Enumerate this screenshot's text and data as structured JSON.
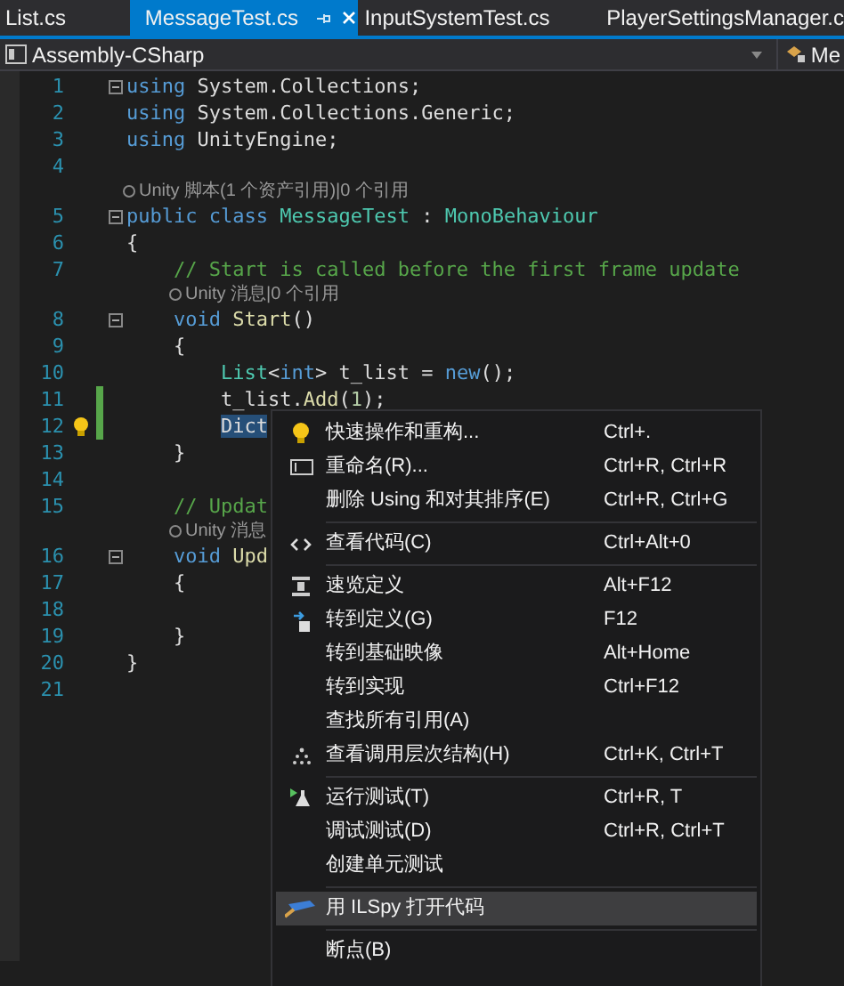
{
  "tabs": [
    {
      "label": "List.cs",
      "selected": false
    },
    {
      "label": "MessageTest.cs",
      "selected": true
    },
    {
      "label": "InputSystemTest.cs",
      "selected": false
    },
    {
      "label": "PlayerSettingsManager.c",
      "selected": false
    }
  ],
  "nav": {
    "project": "Assembly-CSharp",
    "member": "Me"
  },
  "lines": [
    {
      "kind": "code",
      "number": "1",
      "fold": true,
      "changed": false,
      "lightbulb": false,
      "tokens": [
        {
          "kind": "keyword",
          "text": "using"
        },
        {
          "kind": "plain",
          "text": " System.Collections;"
        }
      ]
    },
    {
      "kind": "code",
      "number": "2",
      "fold": false,
      "changed": false,
      "lightbulb": false,
      "tokens": [
        {
          "kind": "keyword",
          "text": "using"
        },
        {
          "kind": "plain",
          "text": " System.Collections.Generic;"
        }
      ]
    },
    {
      "kind": "code",
      "number": "3",
      "fold": false,
      "changed": false,
      "lightbulb": false,
      "tokens": [
        {
          "kind": "keyword",
          "text": "using"
        },
        {
          "kind": "plain",
          "text": " UnityEngine;"
        }
      ]
    },
    {
      "kind": "code",
      "number": "4",
      "fold": false,
      "changed": false,
      "lightbulb": false
    },
    {
      "kind": "lens",
      "text": "Unity 脚本(1 个资产引用)|0 个引用"
    },
    {
      "kind": "code",
      "number": "5",
      "fold": true,
      "changed": false,
      "lightbulb": false,
      "tokens": [
        {
          "kind": "keyword",
          "text": "public class "
        },
        {
          "kind": "type",
          "text": "MessageTest"
        },
        {
          "kind": "plain",
          "text": " : "
        },
        {
          "kind": "type",
          "text": "MonoBehaviour"
        }
      ]
    },
    {
      "kind": "code",
      "number": "6",
      "fold": false,
      "changed": false,
      "lightbulb": false,
      "tokens": [
        {
          "kind": "plain",
          "text": "{"
        }
      ]
    },
    {
      "kind": "code",
      "number": "7",
      "fold": false,
      "changed": false,
      "lightbulb": false,
      "tokens": [
        {
          "kind": "comment",
          "text": "    // Start is called before the first frame update"
        }
      ]
    },
    {
      "kind": "lens",
      "text": "Unity 消息|0 个引用"
    },
    {
      "kind": "code",
      "number": "8",
      "fold": true,
      "changed": false,
      "lightbulb": false,
      "tokens": [
        {
          "kind": "keyword",
          "text": "    void "
        },
        {
          "kind": "method",
          "text": "Start"
        },
        {
          "kind": "plain",
          "text": "()"
        }
      ]
    },
    {
      "kind": "code",
      "number": "9",
      "fold": false,
      "changed": false,
      "lightbulb": false,
      "tokens": [
        {
          "kind": "plain",
          "text": "    {"
        }
      ]
    },
    {
      "kind": "code",
      "number": "10",
      "fold": false,
      "changed": false,
      "lightbulb": false,
      "tokens": [
        {
          "kind": "type",
          "text": "        List"
        },
        {
          "kind": "plain",
          "text": "<"
        },
        {
          "kind": "keyword",
          "text": "int"
        },
        {
          "kind": "plain",
          "text": "> t_list = "
        },
        {
          "kind": "keyword",
          "text": "new"
        },
        {
          "kind": "plain",
          "text": "();"
        }
      ]
    },
    {
      "kind": "code",
      "number": "11",
      "fold": false,
      "changed": true,
      "lightbulb": false,
      "tokens": [
        {
          "kind": "plain",
          "text": "        t_list."
        },
        {
          "kind": "method",
          "text": "Add"
        },
        {
          "kind": "plain",
          "text": "("
        },
        {
          "kind": "number",
          "text": "1"
        },
        {
          "kind": "plain",
          "text": ");"
        }
      ]
    },
    {
      "kind": "code",
      "number": "12",
      "fold": false,
      "changed": true,
      "lightbulb": true,
      "tokens": [
        {
          "kind": "selection",
          "text": "        Dict"
        }
      ]
    },
    {
      "kind": "code",
      "number": "13",
      "fold": false,
      "changed": false,
      "lightbulb": false,
      "tokens": [
        {
          "kind": "plain",
          "text": "    }"
        }
      ]
    },
    {
      "kind": "code",
      "number": "14",
      "fold": false,
      "changed": false,
      "lightbulb": false
    },
    {
      "kind": "code",
      "number": "15",
      "fold": false,
      "changed": false,
      "lightbulb": false,
      "tokens": [
        {
          "kind": "comment",
          "text": "    // Updat"
        }
      ]
    },
    {
      "kind": "lens",
      "text": "Unity 消息"
    },
    {
      "kind": "code",
      "number": "16",
      "fold": true,
      "changed": false,
      "lightbulb": false,
      "tokens": [
        {
          "kind": "keyword",
          "text": "    void "
        },
        {
          "kind": "method",
          "text": "Upd"
        }
      ]
    },
    {
      "kind": "code",
      "number": "17",
      "fold": false,
      "changed": false,
      "lightbulb": false,
      "tokens": [
        {
          "kind": "plain",
          "text": "    {"
        }
      ]
    },
    {
      "kind": "code",
      "number": "18",
      "fold": false,
      "changed": false,
      "lightbulb": false
    },
    {
      "kind": "code",
      "number": "19",
      "fold": false,
      "changed": false,
      "lightbulb": false,
      "tokens": [
        {
          "kind": "plain",
          "text": "    }"
        }
      ]
    },
    {
      "kind": "code",
      "number": "20",
      "fold": false,
      "changed": false,
      "lightbulb": false,
      "tokens": [
        {
          "kind": "plain",
          "text": "}"
        }
      ]
    },
    {
      "kind": "code",
      "number": "21",
      "fold": false,
      "changed": false,
      "lightbulb": false
    }
  ],
  "menu": [
    {
      "kind": "item",
      "label": "快速操作和重构...",
      "shortcut": "Ctrl+.",
      "selected": false
    },
    {
      "kind": "item",
      "label": "重命名(R)...",
      "shortcut": "Ctrl+R, Ctrl+R",
      "selected": false
    },
    {
      "kind": "item",
      "label": "删除 Using 和对其排序(E)",
      "shortcut": "Ctrl+R, Ctrl+G",
      "selected": false
    },
    {
      "kind": "separator"
    },
    {
      "kind": "item",
      "label": "查看代码(C)",
      "shortcut": "Ctrl+Alt+0",
      "selected": false
    },
    {
      "kind": "separator"
    },
    {
      "kind": "item",
      "label": "速览定义",
      "shortcut": "Alt+F12",
      "selected": false
    },
    {
      "kind": "item",
      "label": "转到定义(G)",
      "shortcut": "F12",
      "selected": false
    },
    {
      "kind": "item",
      "label": "转到基础映像",
      "shortcut": "Alt+Home",
      "selected": false
    },
    {
      "kind": "item",
      "label": "转到实现",
      "shortcut": "Ctrl+F12",
      "selected": false
    },
    {
      "kind": "item",
      "label": "查找所有引用(A)",
      "selected": false
    },
    {
      "kind": "item",
      "label": "查看调用层次结构(H)",
      "shortcut": "Ctrl+K, Ctrl+T",
      "selected": false
    },
    {
      "kind": "separator"
    },
    {
      "kind": "item",
      "label": "运行测试(T)",
      "shortcut": "Ctrl+R, T",
      "selected": false
    },
    {
      "kind": "item",
      "label": "调试测试(D)",
      "shortcut": "Ctrl+R, Ctrl+T",
      "selected": false
    },
    {
      "kind": "item",
      "label": "创建单元测试",
      "selected": false
    },
    {
      "kind": "separator"
    },
    {
      "kind": "item",
      "label": "用 ILSpy 打开代码",
      "selected": true
    },
    {
      "kind": "separator"
    },
    {
      "kind": "item",
      "label": "断点(B)",
      "selected": false
    }
  ]
}
